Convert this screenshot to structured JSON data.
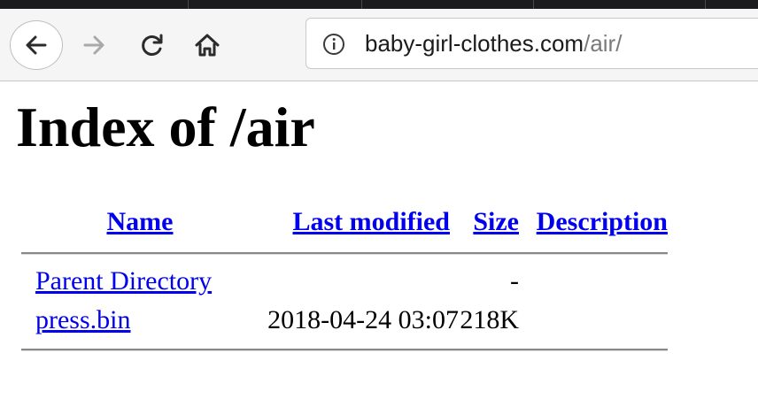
{
  "browser": {
    "url_host": "baby-girl-clothes.com",
    "url_path": "/air/",
    "icons": {
      "back": "back-arrow-icon",
      "forward": "forward-arrow-icon",
      "reload": "reload-icon",
      "home": "home-icon",
      "site_info": "info-icon"
    }
  },
  "page": {
    "title": "Index of /air",
    "columns": {
      "name": "Name",
      "last_modified": "Last modified",
      "size": "Size",
      "description": "Description"
    },
    "rows": [
      {
        "name": "Parent Directory",
        "last_modified": "",
        "size": "-",
        "description": ""
      },
      {
        "name": "press.bin",
        "last_modified": "2018-04-24 03:07",
        "size": "218K",
        "description": ""
      }
    ]
  },
  "colors": {
    "link": "#0000ee",
    "toolbar_bg": "#f5f5f5",
    "tabstrip_bg": "#1c1c1e"
  }
}
